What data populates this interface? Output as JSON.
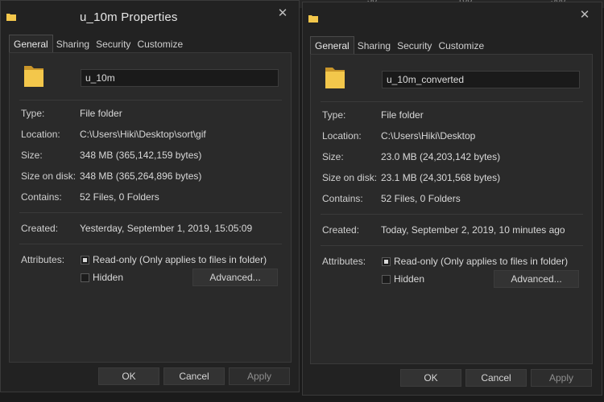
{
  "backdrop": {
    "fragments": [
      "30",
      "100",
      "500"
    ]
  },
  "windows": [
    {
      "title": "u_10m Properties",
      "close_glyph": "✕",
      "tabs": [
        {
          "label": "General",
          "active": true
        },
        {
          "label": "Sharing",
          "active": false
        },
        {
          "label": "Security",
          "active": false
        },
        {
          "label": "Customize",
          "active": false
        }
      ],
      "name_value": "u_10m",
      "fields": {
        "type_label": "Type:",
        "type": "File folder",
        "location_label": "Location:",
        "location": "C:\\Users\\Hiki\\Desktop\\sort\\gif",
        "size_label": "Size:",
        "size": "348 MB (365,142,159 bytes)",
        "size_on_disk_label": "Size on disk:",
        "size_on_disk": "348 MB (365,264,896 bytes)",
        "contains_label": "Contains:",
        "contains": "52 Files, 0 Folders",
        "created_label": "Created:",
        "created": "Yesterday, September 1, 2019, 15:05:09",
        "attributes_label": "Attributes:",
        "readonly_label": "Read-only (Only applies to files in folder)",
        "hidden_label": "Hidden",
        "advanced_label": "Advanced..."
      },
      "buttons": {
        "ok": "OK",
        "cancel": "Cancel",
        "apply": "Apply"
      }
    },
    {
      "title": "",
      "close_glyph": "✕",
      "tabs": [
        {
          "label": "General",
          "active": true
        },
        {
          "label": "Sharing",
          "active": false
        },
        {
          "label": "Security",
          "active": false
        },
        {
          "label": "Customize",
          "active": false
        }
      ],
      "name_value": "u_10m_converted",
      "fields": {
        "type_label": "Type:",
        "type": "File folder",
        "location_label": "Location:",
        "location": "C:\\Users\\Hiki\\Desktop",
        "size_label": "Size:",
        "size": "23.0 MB (24,203,142 bytes)",
        "size_on_disk_label": "Size on disk:",
        "size_on_disk": "23.1 MB (24,301,568 bytes)",
        "contains_label": "Contains:",
        "contains": "52 Files, 0 Folders",
        "created_label": "Created:",
        "created": "Today, September 2, 2019, 10 minutes ago",
        "attributes_label": "Attributes:",
        "readonly_label": "Read-only (Only applies to files in folder)",
        "hidden_label": "Hidden",
        "advanced_label": "Advanced..."
      },
      "buttons": {
        "ok": "OK",
        "cancel": "Cancel",
        "apply": "Apply"
      }
    }
  ],
  "colors": {
    "window_bg": "#222222",
    "panel_bg": "#2a2a2a",
    "folder_yellow": "#f3c74b",
    "text": "#d4d4d4"
  }
}
